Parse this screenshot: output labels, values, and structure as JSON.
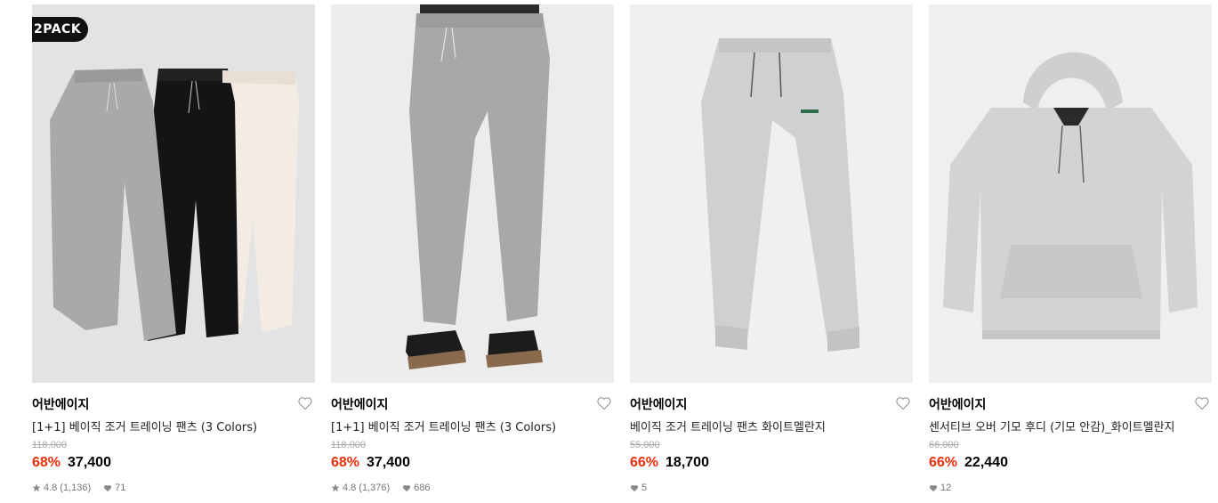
{
  "products": [
    {
      "badge": "2PACK",
      "brand": "어반에이지",
      "title": "[1+1] 베이직 조거 트레이닝 팬츠 (3 Colors)",
      "original_price": "118,000",
      "discount": "68%",
      "price": "37,400",
      "rating": "4.8",
      "review_count": "(1,136)",
      "likes": "71",
      "image_bg": "#e3e3e3"
    },
    {
      "brand": "어반에이지",
      "title": "[1+1] 베이직 조거 트레이닝 팬츠 (3 Colors)",
      "original_price": "118,000",
      "discount": "68%",
      "price": "37,400",
      "rating": "4.8",
      "review_count": "(1,376)",
      "likes": "686",
      "image_bg": "#ececec"
    },
    {
      "brand": "어반에이지",
      "title": "베이직 조거 트레이닝 팬츠 화이트멜란지",
      "original_price": "55,000",
      "discount": "66%",
      "price": "18,700",
      "likes": "5",
      "image_bg": "#f0f0f0"
    },
    {
      "brand": "어반에이지",
      "title": "센서티브 오버 기모 후디 (기모 안감)_화이트멜란지",
      "original_price": "66,000",
      "discount": "66%",
      "price": "22,440",
      "likes": "12",
      "image_bg": "#efefef"
    }
  ],
  "colors": {
    "discount": "#e8300b",
    "muted": "#777777",
    "strike": "#aaaaaa"
  },
  "icons": {
    "like": "heart-outline-icon",
    "rating": "star-icon",
    "likes_count": "heart-filled-icon"
  }
}
